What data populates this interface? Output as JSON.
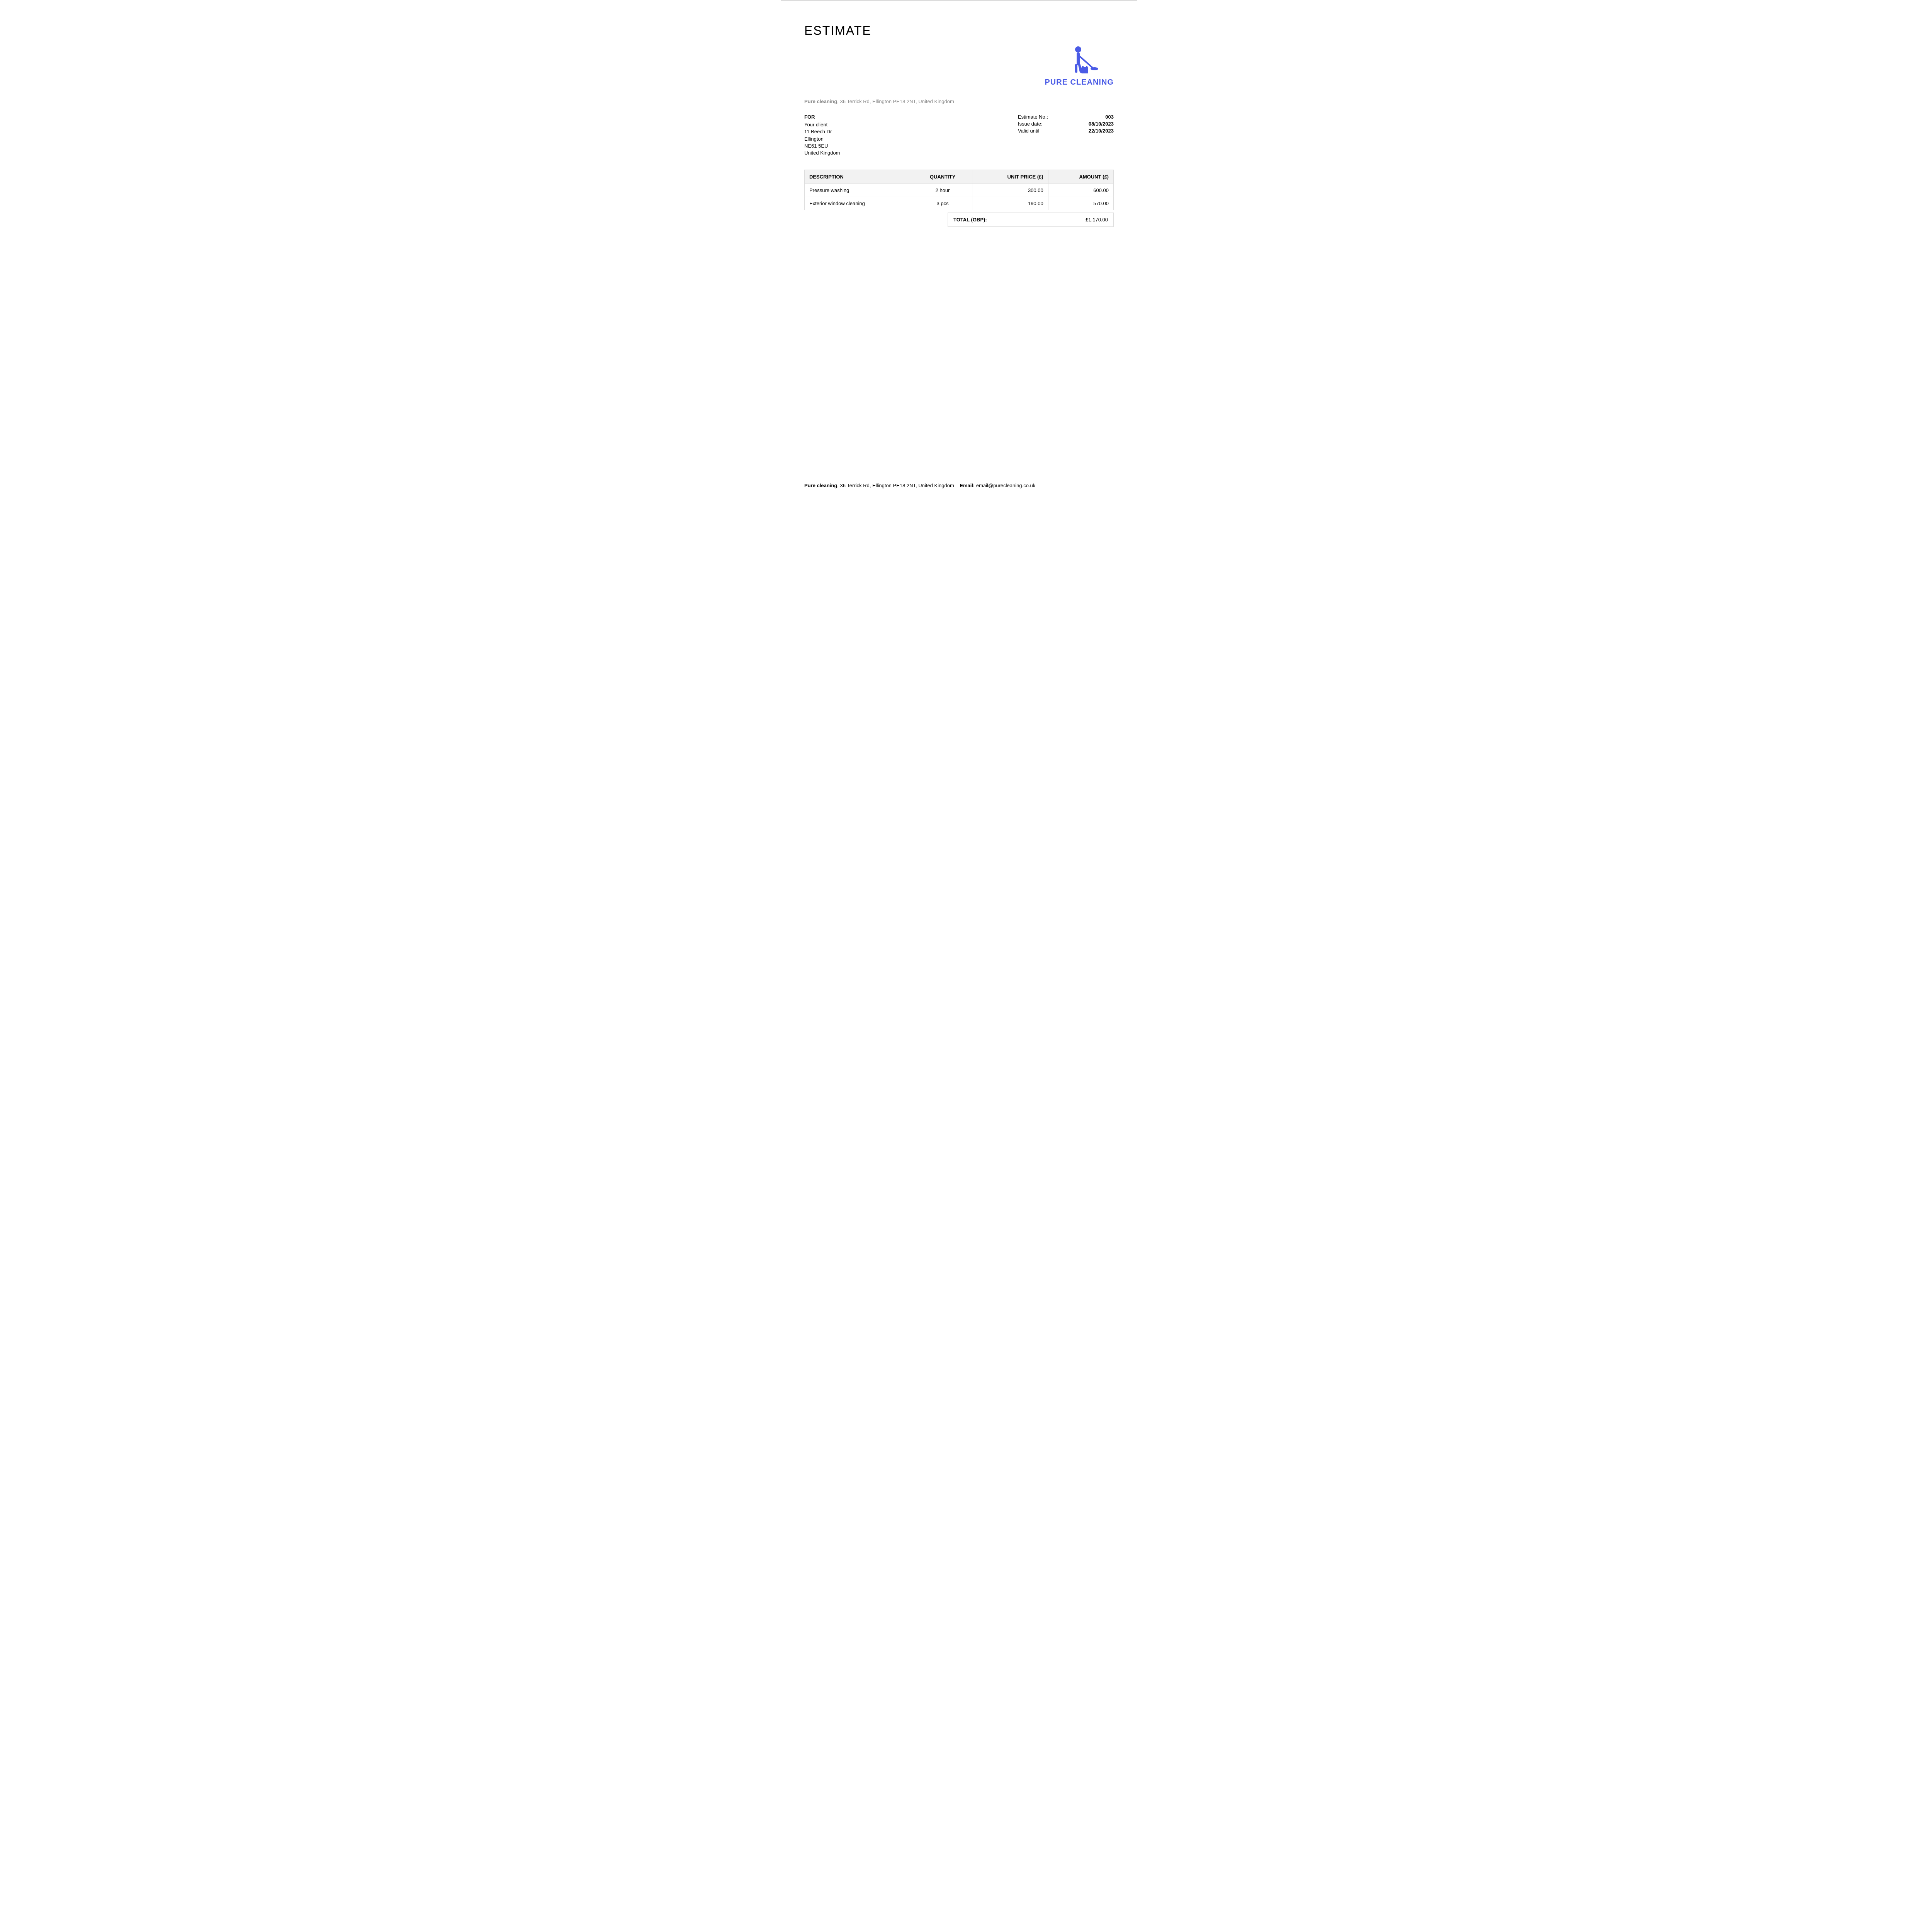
{
  "title": "ESTIMATE",
  "logo": {
    "brand_name": "PURE CLEANING",
    "color": "#4a5be6"
  },
  "company": {
    "name": "Pure cleaning",
    "address": "36 Terrick Rd, Ellington PE18 2NT, United Kingdom"
  },
  "client": {
    "for_label": "FOR",
    "name": "Your client",
    "street": "11 Beech Dr",
    "city": "Ellington",
    "postcode": "NE61 5EU",
    "country": "United Kingdom"
  },
  "meta": {
    "estimate_no_label": "Estimate No.:",
    "estimate_no": "003",
    "issue_date_label": "Issue date:",
    "issue_date": "08/10/2023",
    "valid_until_label": "Valid until",
    "valid_until": "22/10/2023"
  },
  "table": {
    "headers": {
      "description": "DESCRIPTION",
      "quantity": "QUANTITY",
      "unit_price": "UNIT PRICE (£)",
      "amount": "AMOUNT (£)"
    },
    "rows": [
      {
        "description": "Pressure washing",
        "quantity": "2 hour",
        "unit_price": "300.00",
        "amount": "600.00"
      },
      {
        "description": "Exterior window cleaning",
        "quantity": "3 pcs",
        "unit_price": "190.00",
        "amount": "570.00"
      }
    ],
    "total_label": "TOTAL (GBP):",
    "total_value": "£1,170.00"
  },
  "footer": {
    "company_name": "Pure cleaning",
    "address": ", 36 Terrick Rd, Ellington PE18 2NT, United Kingdom",
    "email_label": "Email:",
    "email": "email@purecleaning.co.uk"
  }
}
